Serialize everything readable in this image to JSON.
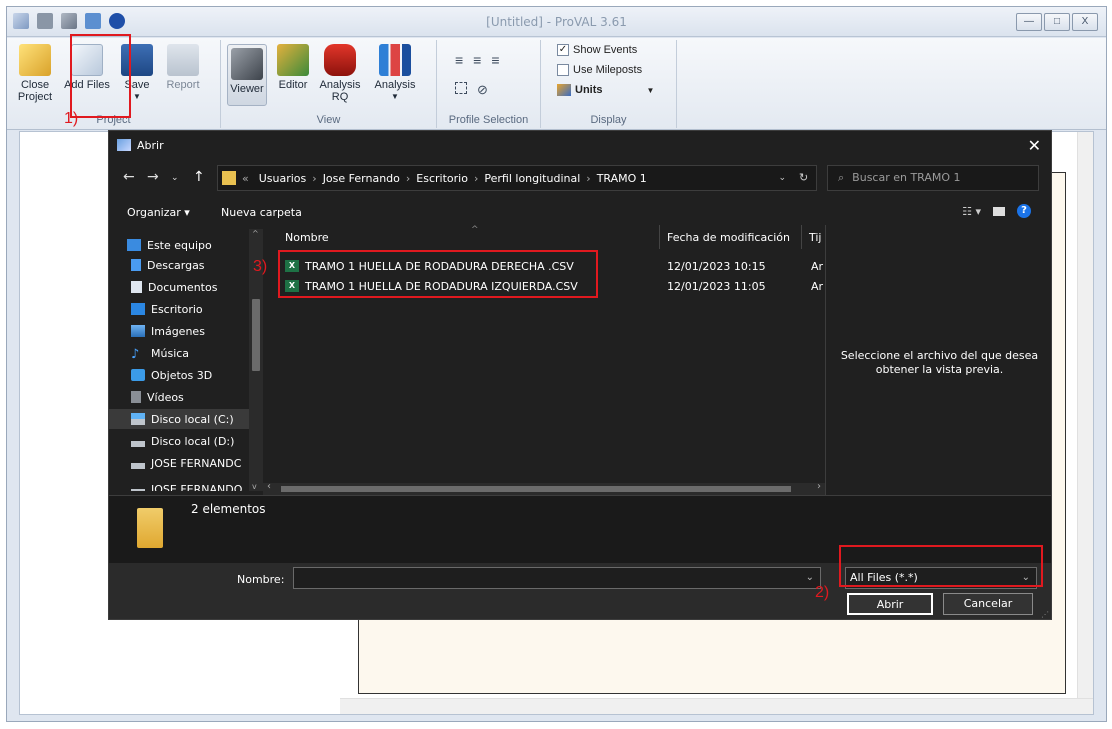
{
  "app": {
    "title": "[Untitled] - ProVAL 3.61",
    "window_controls": [
      "—",
      "□",
      "X"
    ]
  },
  "ribbon": {
    "project": {
      "label": "Project",
      "buttons": [
        {
          "label": "Close Project",
          "icon": "folder-icon"
        },
        {
          "label": "Add Files",
          "icon": "add-file-icon"
        },
        {
          "label": "Save",
          "icon": "floppy-icon"
        },
        {
          "label": "Report",
          "icon": "report-icon"
        }
      ]
    },
    "view": {
      "label": "View",
      "buttons": [
        {
          "label": "Viewer",
          "icon": "binoculars-icon"
        },
        {
          "label": "Editor",
          "icon": "pencil-ruler-icon"
        },
        {
          "label": "Analysis RQ",
          "icon": "car-icon"
        },
        {
          "label": "Analysis",
          "icon": "bar-chart-icon"
        }
      ]
    },
    "profile_selection": {
      "label": "Profile Selection"
    },
    "display": {
      "label": "Display",
      "show_events": "Show Events",
      "use_mileposts": "Use Mileposts",
      "units": "Units"
    }
  },
  "annotations": {
    "a1": "1)",
    "a2": "2)",
    "a3": "3)"
  },
  "dialog": {
    "title": "Abrir",
    "breadcrumb": [
      "«",
      "Usuarios",
      "Jose Fernando",
      "Escritorio",
      "Perfil longitudinal",
      "TRAMO 1"
    ],
    "search_placeholder": "Buscar en TRAMO 1",
    "organizar": "Organizar ▾",
    "nueva_carpeta": "Nueva carpeta",
    "nav_items": [
      {
        "label": "Este equipo",
        "icon": "computer-icon"
      },
      {
        "label": "Descargas",
        "icon": "download-icon"
      },
      {
        "label": "Documentos",
        "icon": "document-icon"
      },
      {
        "label": "Escritorio",
        "icon": "desktop-icon"
      },
      {
        "label": "Imágenes",
        "icon": "image-icon"
      },
      {
        "label": "Música",
        "icon": "music-icon"
      },
      {
        "label": "Objetos 3D",
        "icon": "cube-icon"
      },
      {
        "label": "Vídeos",
        "icon": "video-icon"
      },
      {
        "label": "Disco local (C:)",
        "icon": "drive-icon"
      },
      {
        "label": "Disco local (D:)",
        "icon": "drive-icon"
      },
      {
        "label": "JOSE FERNANDC",
        "icon": "drive-icon"
      },
      {
        "label": "JOSE FERNANDO",
        "icon": "drive-icon"
      }
    ],
    "columns": {
      "name": "Nombre",
      "modified": "Fecha de modificación",
      "type": "Tij"
    },
    "files": [
      {
        "name": "TRAMO 1 HUELLA DE RODADURA DERECHA .CSV",
        "modified": "12/01/2023 10:15",
        "type": "Ar"
      },
      {
        "name": "TRAMO 1 HUELLA DE RODADURA IZQUIERDA.CSV",
        "modified": "12/01/2023 11:05",
        "type": "Ar"
      }
    ],
    "preview_message": "Seleccione el archivo del que desea obtener la vista previa.",
    "item_count": "2 elementos",
    "filename_label": "Nombre:",
    "filename_value": "",
    "file_type": "All Files (*.*)",
    "open_button": "Abrir",
    "cancel_button": "Cancelar"
  }
}
